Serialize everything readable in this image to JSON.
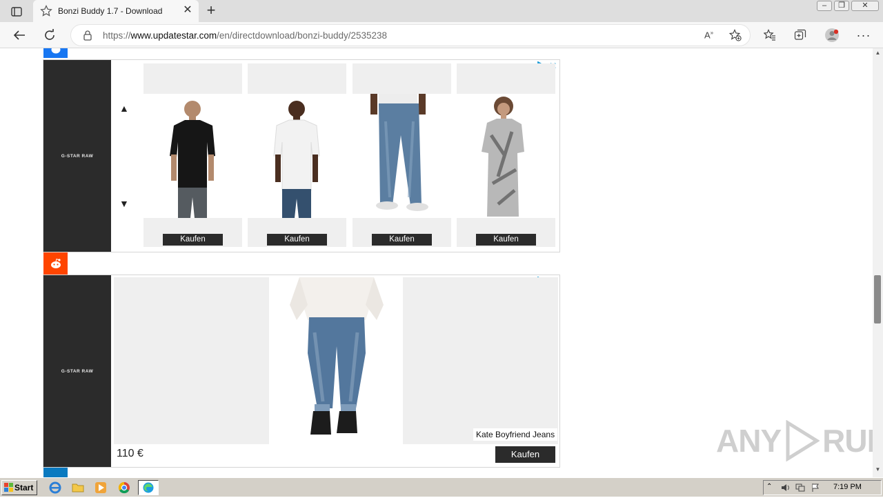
{
  "browser": {
    "tab_title": "Bonzi Buddy 1.7 - Download",
    "url_prefix": "https://",
    "url_domain": "www.updatestar.com",
    "url_path": "/en/directdownload/bonzi-buddy/2535238",
    "read_aloud_icon": "A ̩",
    "window_controls": [
      "minimize",
      "restore",
      "close"
    ]
  },
  "ad1": {
    "brand": "G-STAR RAW",
    "arrow_up": "▲",
    "arrow_down": "▼",
    "products": [
      {
        "button": "Kaufen",
        "image": "man-black-tshirt"
      },
      {
        "button": "Kaufen",
        "image": "man-white-tshirt"
      },
      {
        "button": "Kaufen",
        "image": "jeans"
      },
      {
        "button": "Kaufen",
        "image": "woman-printed-dress"
      }
    ]
  },
  "ad2": {
    "brand": "G-STAR RAW",
    "product_name": "Kate Boyfriend Jeans",
    "price": "110 €",
    "button": "Kaufen"
  },
  "watermark": {
    "left": "ANY",
    "right": "RUN"
  },
  "taskbar": {
    "start_label": "Start",
    "clock": "7:19 PM",
    "apps": [
      "ie-icon",
      "folder-icon",
      "media-player-icon",
      "chrome-icon",
      "edge-icon"
    ]
  },
  "colors": {
    "brand_panel": "#2b2b2b",
    "adchoices": "#1a9ad6",
    "reddit": "#ff4500",
    "messenger": "#1877f2"
  }
}
